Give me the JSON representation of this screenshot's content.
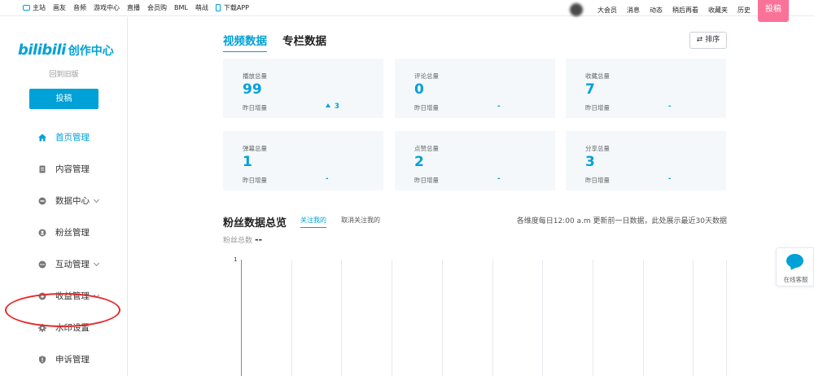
{
  "topbar": {
    "left_items": [
      "主站",
      "画友",
      "音频",
      "游戏中心",
      "直播",
      "会员购",
      "BML",
      "萌战",
      "下载APP"
    ],
    "right_items": [
      "大会员",
      "消息",
      "动态",
      "稍后再看",
      "收藏夹",
      "历史"
    ],
    "upload": "投稿"
  },
  "sidebar": {
    "logo_bili": "bilibili",
    "logo_text": "创作中心",
    "back_old": "回到旧版",
    "upload": "投稿",
    "items": [
      {
        "label": "首页管理",
        "icon": "home-icon"
      },
      {
        "label": "内容管理",
        "icon": "document-icon"
      },
      {
        "label": "数据中心",
        "icon": "data-icon"
      },
      {
        "label": "粉丝管理",
        "icon": "fans-icon"
      },
      {
        "label": "互动管理",
        "icon": "chat-icon"
      },
      {
        "label": "收益管理",
        "icon": "income-icon"
      },
      {
        "label": "水印设置",
        "icon": "gear-icon"
      },
      {
        "label": "申诉管理",
        "icon": "shield-icon"
      }
    ]
  },
  "main": {
    "tabs": [
      "视频数据",
      "专栏数据"
    ],
    "sort": "⇄ 排序",
    "cards": [
      {
        "label": "播放总量",
        "value": "99",
        "yesterday_label": "昨日增量",
        "yesterday_value": "3",
        "trend": "up"
      },
      {
        "label": "评论总量",
        "value": "0",
        "yesterday_label": "昨日增量",
        "yesterday_value": "-"
      },
      {
        "label": "收藏总量",
        "value": "7",
        "yesterday_label": "昨日增量",
        "yesterday_value": "-"
      },
      {
        "label": "弹幕总量",
        "value": "1",
        "yesterday_label": "昨日增量",
        "yesterday_value": "-"
      },
      {
        "label": "点赞总量",
        "value": "2",
        "yesterday_label": "昨日增量",
        "yesterday_value": "-"
      },
      {
        "label": "分享总量",
        "value": "3",
        "yesterday_label": "昨日增量",
        "yesterday_value": "-"
      }
    ],
    "fans": {
      "title": "粉丝数据总览",
      "tab_follow": "关注我的",
      "tab_unfollow": "取消关注我的",
      "note": "各维度每日12:00 a.m 更新前一日数据，此处展示最近30天数据",
      "total_label": "粉丝总数",
      "total_value": "--",
      "chart_tick": "1"
    }
  },
  "float_service": {
    "label": "在线客服"
  },
  "colors": {
    "accent": "#00a1d6",
    "pink": "#fb7299",
    "highlight": "#e52a2a"
  }
}
